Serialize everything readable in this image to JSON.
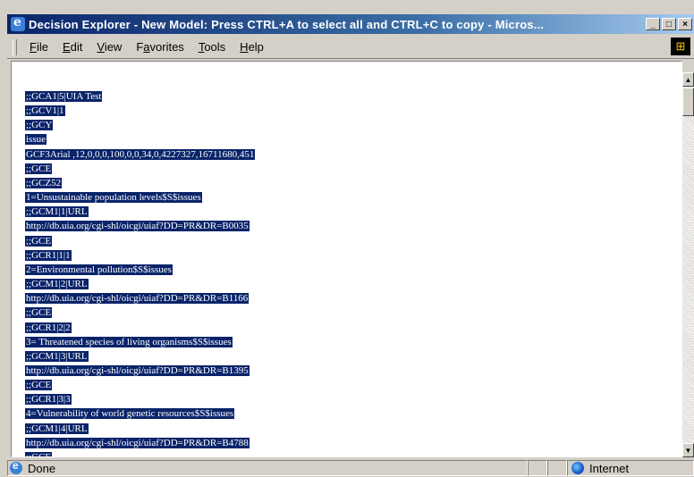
{
  "window": {
    "title": "Decision Explorer - New Model: Press CTRL+A to select all and CTRL+C to copy - Micros...",
    "controls": {
      "minimize": "_",
      "maximize": "□",
      "close": "×"
    }
  },
  "menu": [
    {
      "accel": "F",
      "rest": "ile"
    },
    {
      "accel": "E",
      "rest": "dit"
    },
    {
      "accel": "V",
      "rest": "iew"
    },
    {
      "pre": "F",
      "accel": "a",
      "rest": "vorites"
    },
    {
      "accel": "T",
      "rest": "ools"
    },
    {
      "accel": "H",
      "rest": "elp"
    }
  ],
  "content": {
    "lines": [
      ";;GCA1|5|UIA Test",
      ";;GCV1|1",
      ";;GCY",
      "issue",
      "GCF3Arial ,12,0,0,0,100,0,0,34,0,4227327,16711680,451",
      ";;GCE",
      ";;GCZ52",
      "1=Unsustainable population levels$S$issues",
      ";;GCM1|1|URL",
      "http://db.uia.org/cgi-shl/oicgi/uiaf?DD=PR&DR=B0035",
      ";;GCE",
      ";;GCR1|1|1",
      "2=Environmental pollution$S$issues",
      ";;GCM1|2|URL",
      "http://db.uia.org/cgi-shl/oicgi/uiaf?DD=PR&DR=B1166",
      ";;GCE",
      ";;GCR1|2|2",
      "3= Threatened species of living organisms$S$issues",
      ";;GCM1|3|URL",
      "http://db.uia.org/cgi-shl/oicgi/uiaf?DD=PR&DR=B1395",
      ";;GCE",
      ";;GCR1|3|3",
      "4=Vulnerability of world genetic resources$S$issues",
      ";;GCM1|4|URL",
      "http://db.uia.org/cgi-shl/oicgi/uiaf?DD=PR&DR=B4788",
      ";;GCE"
    ]
  },
  "status": {
    "text": "Done",
    "zone": "Internet"
  },
  "colors": {
    "selection_bg": "#0a246a",
    "selection_fg": "#ffffff",
    "chrome": "#d4d0c8"
  },
  "icons": {
    "app": "ie-logo-icon",
    "windows": "windows-logo-icon",
    "status": "ie-page-icon",
    "zone": "internet-globe-icon"
  }
}
